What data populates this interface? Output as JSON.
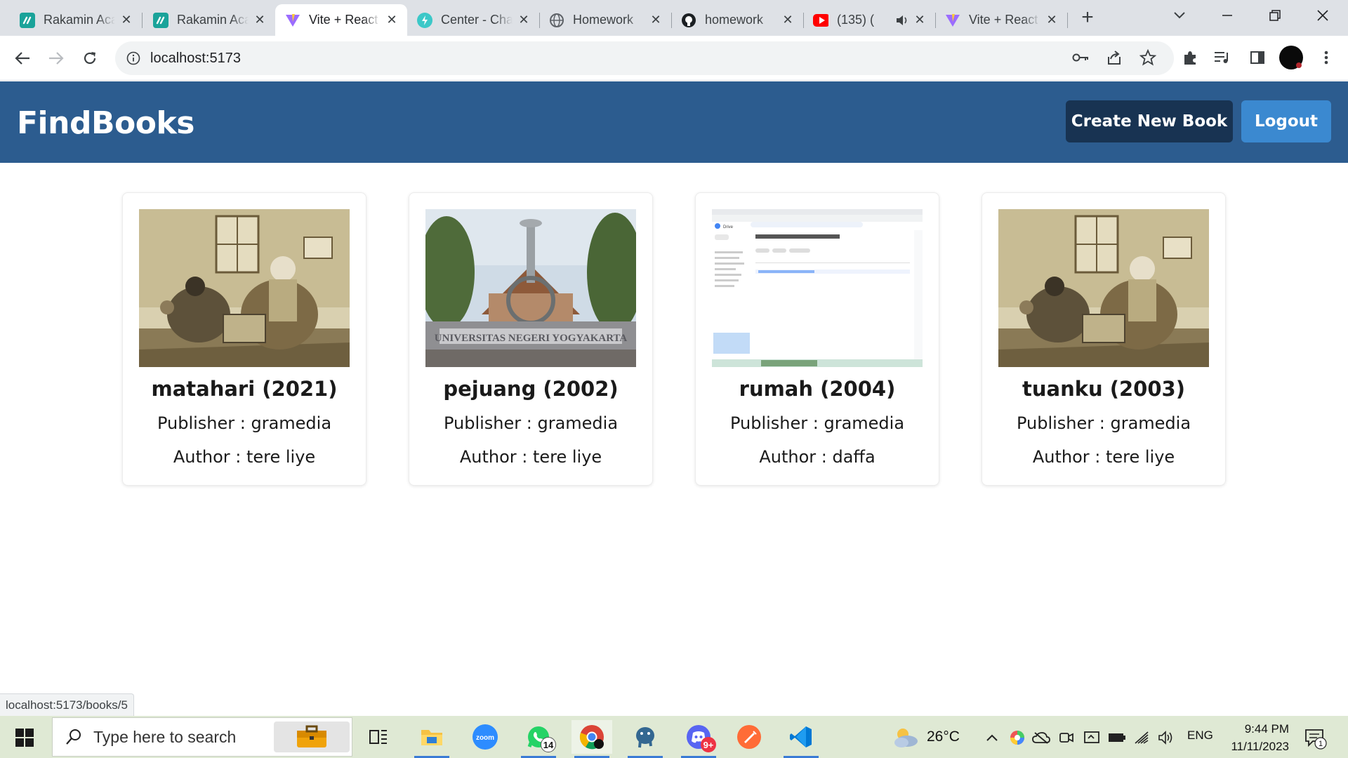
{
  "browser": {
    "tabs": [
      {
        "title": "Rakamin Academy",
        "favicon": "rakamin-icon",
        "color": "#1aa39a"
      },
      {
        "title": "Rakamin Academy",
        "favicon": "rakamin-icon",
        "color": "#1aa39a"
      },
      {
        "title": "Vite + React",
        "favicon": "vite-icon",
        "active": true
      },
      {
        "title": "Center - Chakra UI",
        "favicon": "chakra-icon",
        "color": "#3cc8c8"
      },
      {
        "title": "Homework",
        "favicon": "globe-icon"
      },
      {
        "title": "homework",
        "favicon": "github-icon"
      },
      {
        "title": "(135) (",
        "favicon": "youtube-icon",
        "color": "#ff0000",
        "audio": true
      },
      {
        "title": "Vite + React",
        "favicon": "vite-icon"
      }
    ],
    "close_glyph": "✕",
    "url": "localhost:5173",
    "status_link": "localhost:5173/books/5"
  },
  "app": {
    "brand": "FindBooks",
    "create_label": "Create New Book",
    "logout_label": "Logout",
    "accent_dark": "#183352",
    "accent_light": "#3b89d0",
    "header_color": "#2c5c8f"
  },
  "books": [
    {
      "title": "matahari (2021)",
      "publisher": "Publisher : gramedia",
      "author": "Author : tere liye",
      "cover": "painting-scholar"
    },
    {
      "title": "pejuang (2002)",
      "publisher": "Publisher : gramedia",
      "author": "Author : tere liye",
      "cover": "campus-monument"
    },
    {
      "title": "rumah (2004)",
      "publisher": "Publisher : gramedia",
      "author": "Author : daffa",
      "cover": "drive-screenshot"
    },
    {
      "title": "tuanku (2003)",
      "publisher": "Publisher : gramedia",
      "author": "Author : tere liye",
      "cover": "painting-scholar"
    }
  ],
  "covers": {
    "campus_sign": "UNIVERSITAS NEGERI YOGYAKARTA",
    "drive_label": "Drive"
  },
  "taskbar": {
    "search_placeholder": "Type here to search",
    "whatsapp_badge": "14",
    "discord_badge": "9+",
    "temperature": "26°C",
    "language": "ENG",
    "time": "9:44 PM",
    "date": "11/11/2023",
    "notifications": "1"
  }
}
